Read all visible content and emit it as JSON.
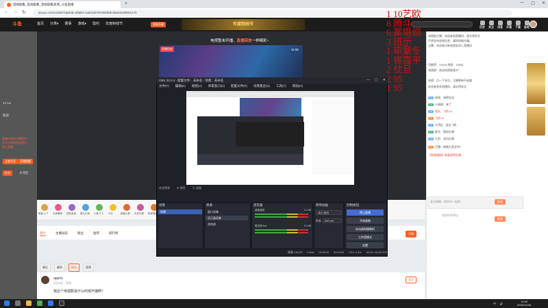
{
  "browser": {
    "tab_title": "电视剧集_电视剧集_电视剧集高清_斗鱼直播",
    "new_tab": "+",
    "url": "douyu.com/12306?dyshid=4b6b4-ca5c51b797291f5dc39a10230002170",
    "window_controls": [
      "—",
      "▢",
      "✕"
    ]
  },
  "site": {
    "logo": "斗鱼",
    "nav": [
      "首页",
      "分类▾",
      "赛事",
      "游戏▾",
      "隐约",
      "年度制线节"
    ],
    "live_button": "我要开播",
    "banner": "年度制线节",
    "header_icons": [
      "历史",
      "关注",
      "消息",
      "开播",
      "下载",
      "鱼吧"
    ]
  },
  "stage": {
    "top_message_prefix": "电视暂未开播，",
    "top_message_highlight": "直播回放",
    "top_message_suffix": "一样精彩~",
    "video_tag": "直播回放",
    "video_time": "11:05"
  },
  "left_panel": {
    "items": [
      "12.1w",
      "陈航"
    ],
    "red_lines": [
      "直播内容由主播提供，",
      "平台不承担相关责任",
      "网上直播"
    ],
    "buttons": [
      "立即关注",
      "开播提醒",
      "办卡"
    ],
    "bottom_label": "大湾区"
  },
  "overlay_text": [
    "1 10艺欧",
    "8 腾斗",
    "6 案堪纲",
    "3 班示",
    "1 筚蘩冬",
    "1 锡露平",
    "2 仗旦",
    "2 95",
    "1 95"
  ],
  "obs": {
    "title": "OBS 32.0.4 - 配置文件：未命名 - 场景：未命名",
    "menu": [
      "文件(F)",
      "编辑(E)",
      "视图(V)",
      "停靠窗口(D)",
      "配置文件(P)",
      "场景集合(S)",
      "工具(T)",
      "帮助(H)"
    ],
    "status_row": [
      "未选择源",
      "⚙ 属性",
      "▥ 滤镜"
    ],
    "docks": {
      "scenes": {
        "title": "场景",
        "items": [
          "场景"
        ]
      },
      "sources": {
        "title": "来源",
        "items": [
          "窗口采集",
          "显示器采集",
          "游戏源"
        ]
      },
      "mixer": {
        "title": "混音器",
        "channels": [
          {
            "name": "桌面音频",
            "db": "0.0 dB"
          },
          {
            "name": "麦克风/Aux",
            "db": "0.0 dB"
          }
        ]
      },
      "transitions": {
        "title": "转场动画",
        "type": "淡入淡出",
        "duration_label": "时长",
        "duration": "300 ms"
      },
      "controls": {
        "title": "控制按钮",
        "buttons": [
          "停止直播",
          "开始录制",
          "启动虚拟摄像机",
          "工作室模式",
          "设置"
        ]
      }
    },
    "footer": [
      "直播 0:00:25",
      "0 kb/s",
      "00:00:00",
      "00:00:00",
      "CPU: 0.4%",
      "60.00 / 60.00 FPS"
    ]
  },
  "gifts": [
    "电影入门",
    "大师黄冠",
    "贴贴宝宝",
    "鱼丸大师",
    "小鱼飞飞",
    "卡片",
    "超级火箭",
    "灰发礼物",
    "帐帐情缘",
    "奇趣礼物"
  ],
  "tabs": {
    "items": [
      "简介",
      "主播动态",
      "粉丝",
      "鱼吧",
      "排行榜"
    ],
    "active": 0,
    "subscribe": "订阅"
  },
  "filters": {
    "items": [
      "最近",
      "最热",
      "精选",
      "视频"
    ],
    "selected": 2
  },
  "comment": {
    "name": "appris",
    "time": "8月28日 · 发表",
    "text": "我这个电视剧说什么时候开播啊？",
    "follow": "关注"
  },
  "chat": {
    "lines": [
      "电视剧主播：欢迎来到直播间，请文明发言",
      "严禁发布违规信息，谨防网络诈骗。",
      "主播：欢迎各位新老朋友进入直播间",
      "贡献榜：24518 热度：15826",
      "电视剧：欢迎电视剧观众！",
      "电视：点一下关注，主播更新不迷路",
      "欢迎来到本直播间，请文明发言",
      "贵族：海绵宝宝",
      "小甜甜：来了",
      "鱼丸：飞机 x1",
      "飞机 x1",
      "大湾区 · 送出飞机",
      "匿名：赠送礼物",
      "七彩：送出礼物",
      "主播：感谢大家支持！",
      "【系统通知】恭喜获得礼物"
    ],
    "input_placeholder": "发出弹幕，和伙伴一起吧",
    "send": "发送",
    "input_placeholder2": "说说你的想法",
    "send2": "发送"
  },
  "taskbar": {
    "time": "13:46",
    "date": "2025/12/28",
    "tray": "中 ⌃ 🔊"
  }
}
